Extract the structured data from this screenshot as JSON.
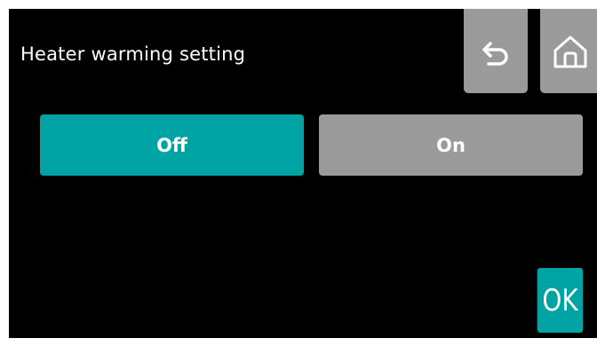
{
  "header": {
    "title": "Heater warming setting"
  },
  "nav": {
    "back_icon": "undo-arrow-icon",
    "home_icon": "home-icon"
  },
  "options": {
    "off_label": "Off",
    "on_label": "On",
    "selected": "Off"
  },
  "footer": {
    "ok_label": "OK"
  },
  "colors": {
    "background": "#000000",
    "accent_selected": "#00a3a3",
    "button_gray": "#9a9a9a",
    "text": "#ffffff"
  }
}
